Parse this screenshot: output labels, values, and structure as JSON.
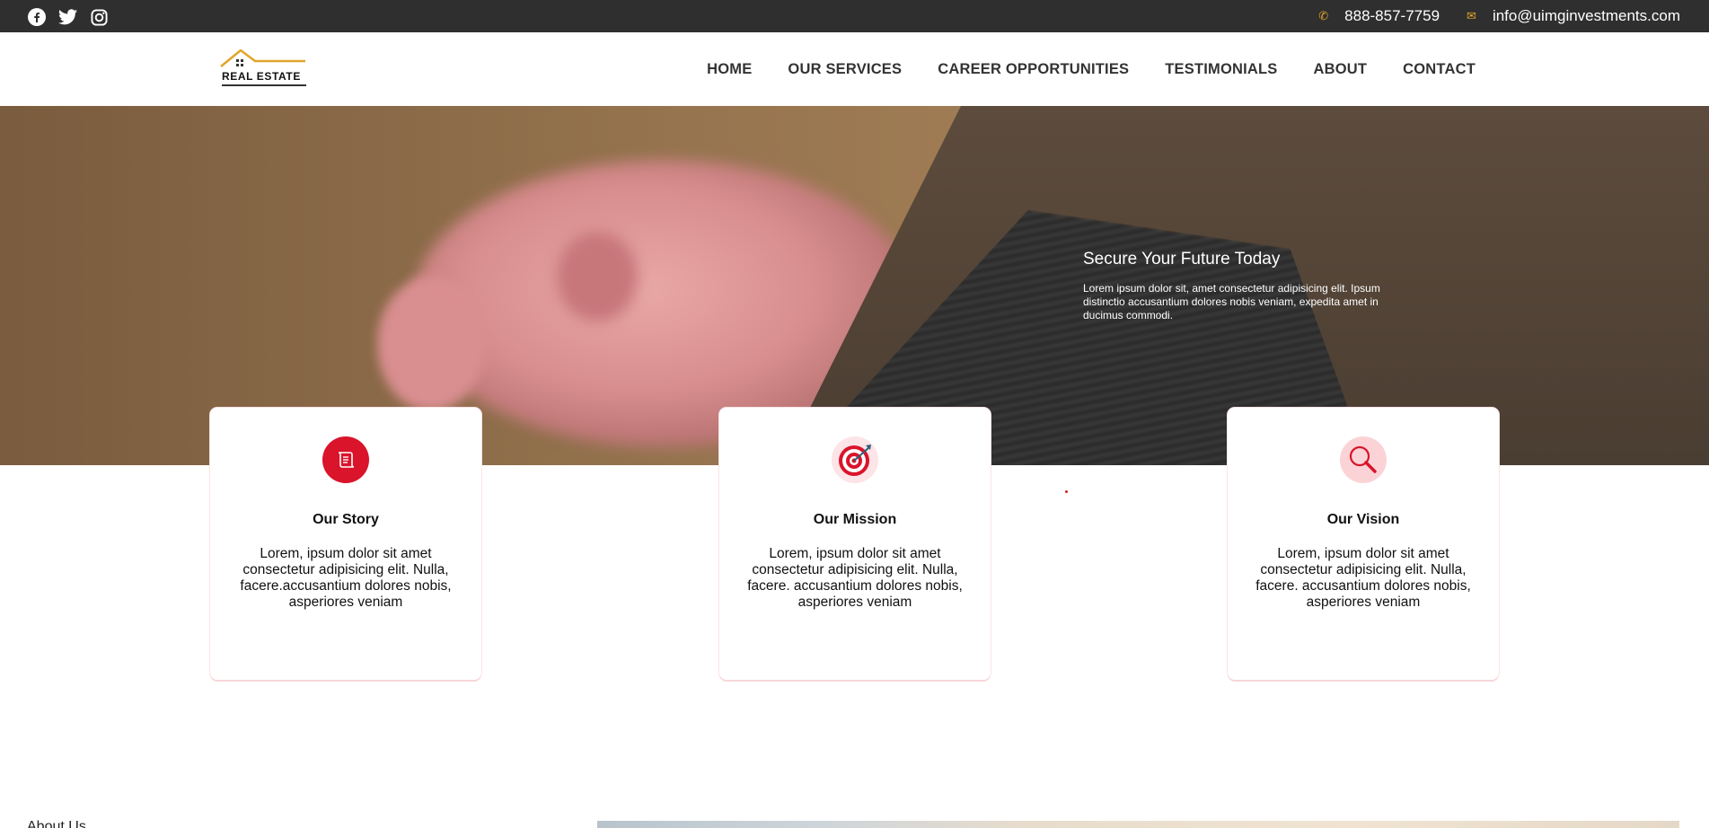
{
  "topbar": {
    "social": [
      "facebook-icon",
      "twitter-icon",
      "instagram-icon"
    ],
    "phone": "888-857-7759",
    "email": "info@uimginvestments.com"
  },
  "header": {
    "logo_text": "REAL ESTATE",
    "nav": [
      "HOME",
      "OUR SERVICES",
      "CAREER OPPORTUNITIES",
      "TESTIMONIALS",
      "ABOUT",
      "CONTACT"
    ]
  },
  "hero": {
    "title": "Secure Your Future Today",
    "body": "Lorem ipsum dolor sit, amet consectetur adipisicing elit. Ipsum distinctio accusantium dolores nobis veniam, expedita amet in ducimus commodi."
  },
  "cards": [
    {
      "icon": "scroll-icon",
      "title": "Our Story",
      "text": "Lorem, ipsum dolor sit amet consectetur adipisicing elit. Nulla, facere.accusantium dolores nobis, asperiores veniam"
    },
    {
      "icon": "target-icon",
      "title": "Our Mission",
      "text": "Lorem, ipsum dolor sit amet consectetur adipisicing elit. Nulla, facere. accusantium dolores nobis, asperiores veniam"
    },
    {
      "icon": "magnifier-icon",
      "title": "Our Vision",
      "text": "Lorem, ipsum dolor sit amet consectetur adipisicing elit. Nulla, facere. accusantium dolores nobis, asperiores veniam"
    }
  ],
  "about": {
    "label": "About Us"
  },
  "colors": {
    "topbar_bg": "#2f2f2f",
    "accent_gold": "#e0a528",
    "accent_red": "#d9142b"
  }
}
